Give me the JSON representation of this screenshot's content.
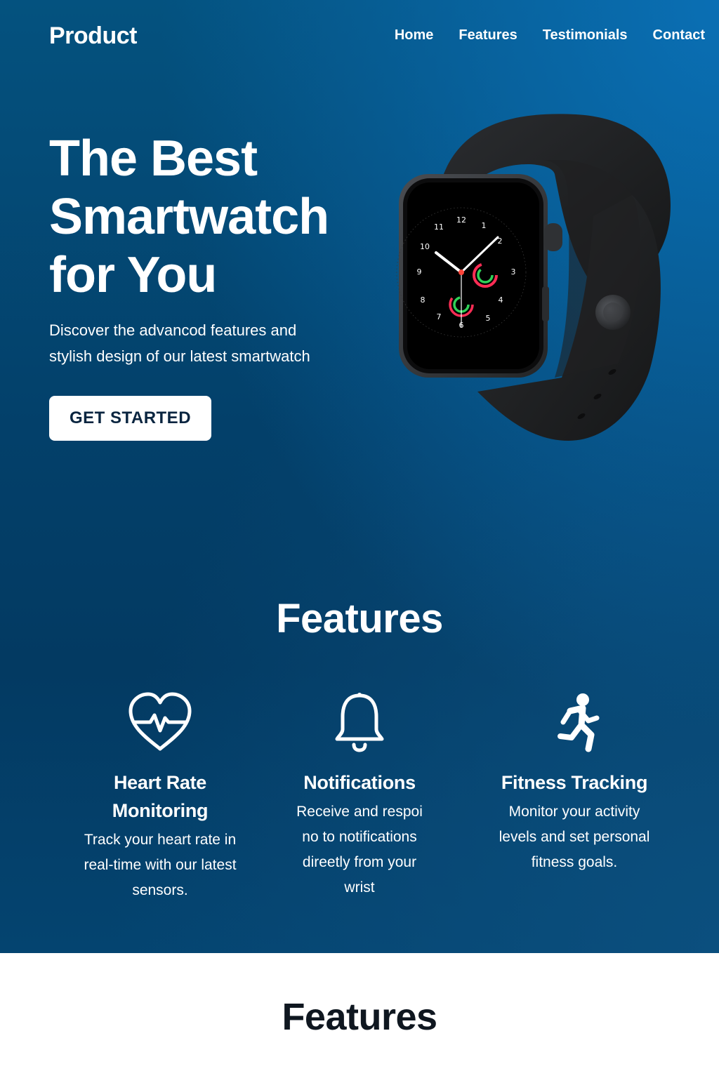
{
  "header": {
    "logo": "Product",
    "nav": [
      "Home",
      "Features",
      "Testimonials",
      "Contact"
    ]
  },
  "hero": {
    "title_line1": "The Best",
    "title_line2": "Smartwatch",
    "title_line3": "for You",
    "subtitle_line1": "Discover the advancod features and",
    "subtitle_line2": "stylish design of our latest smartwatch",
    "cta_label": "GET STARTED"
  },
  "watch_face": {
    "numerals": [
      "12",
      "1",
      "2",
      "3",
      "4",
      "5",
      "6",
      "7",
      "8",
      "9",
      "10",
      "11"
    ]
  },
  "features": {
    "title": "Features",
    "items": [
      {
        "icon": "heart-rate-icon",
        "title_line1": "Heart Rate",
        "title_line2": "Monitoring",
        "desc_line1": "Track your heart rate in",
        "desc_line2": "real-time with our latest",
        "desc_line3": "sensors."
      },
      {
        "icon": "bell-icon",
        "title_line1": "Notifications",
        "desc_line1": "Receive and respoi",
        "desc_line2": "no to notifications",
        "desc_line3": "direetly from your",
        "desc_line4": "wrist"
      },
      {
        "icon": "running-person-icon",
        "title_line1": "Fitness Tracking",
        "desc_line1": "Monitor your activity",
        "desc_line2": "levels and set personal",
        "desc_line3": "fitness goals."
      }
    ]
  },
  "bottom_section": {
    "title": "Features"
  },
  "colors": {
    "hero_top": "#04527f",
    "hero_bottom": "#033a62",
    "button_bg": "#ffffff",
    "button_text": "#0a2540",
    "ring_red": "#ff2d55",
    "ring_green": "#30d158"
  }
}
